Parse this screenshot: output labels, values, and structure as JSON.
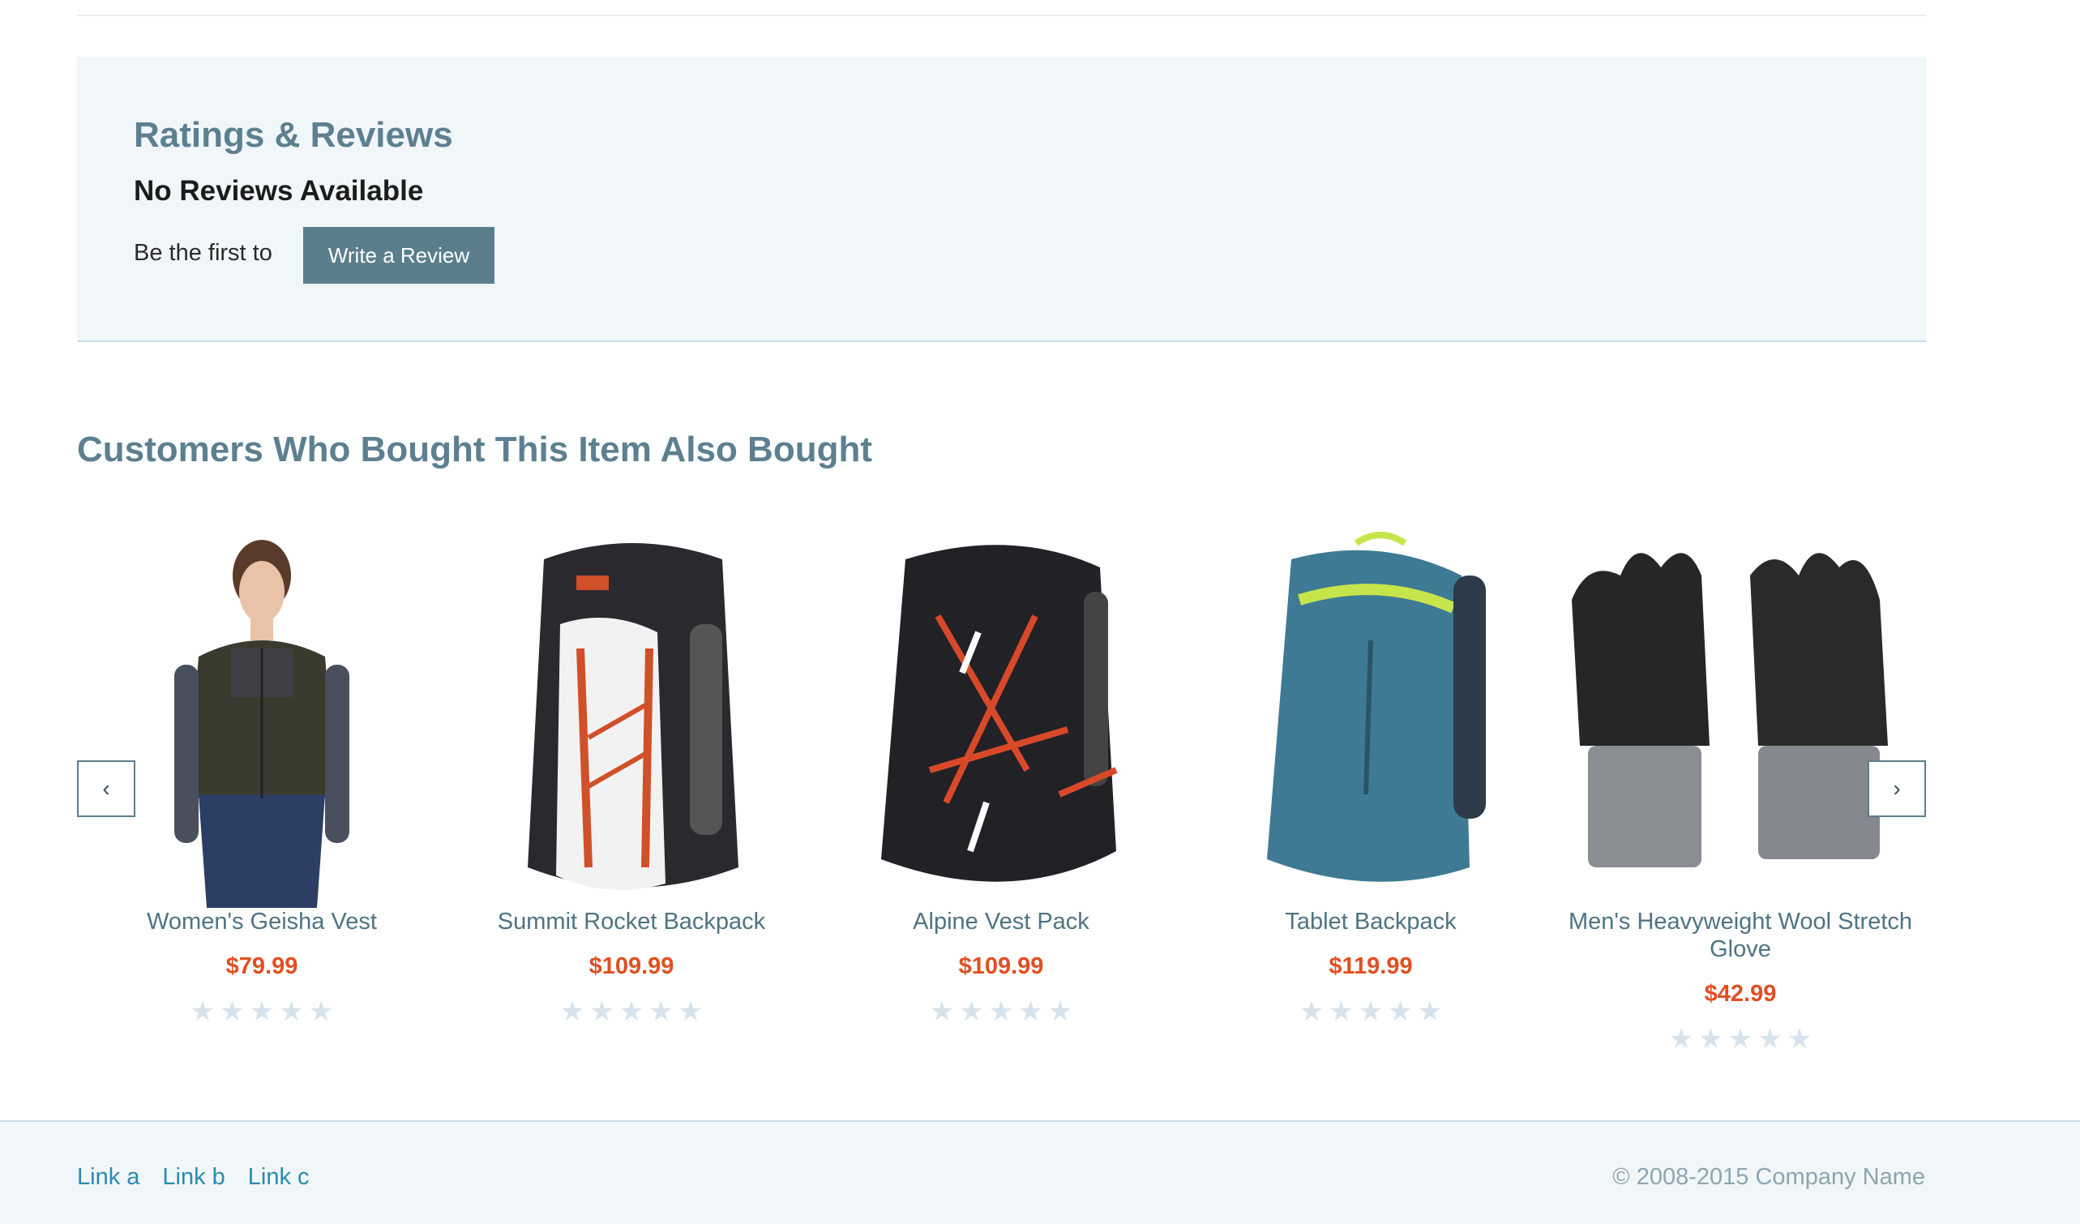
{
  "reviews": {
    "title": "Ratings & Reviews",
    "empty_text": "No Reviews Available",
    "prompt": "Be the first to",
    "write_button": "Write a Review"
  },
  "also_bought": {
    "title": "Customers Who Bought This Item Also Bought",
    "prev_icon": "chevron-left-icon",
    "next_icon": "chevron-right-icon",
    "items": [
      {
        "name": "Women's Geisha Vest",
        "price": "$79.99",
        "rating": 0,
        "max_rating": 5
      },
      {
        "name": "Summit Rocket Backpack",
        "price": "$109.99",
        "rating": 0,
        "max_rating": 5
      },
      {
        "name": "Alpine Vest Pack",
        "price": "$109.99",
        "rating": 0,
        "max_rating": 5
      },
      {
        "name": "Tablet Backpack",
        "price": "$119.99",
        "rating": 0,
        "max_rating": 5
      },
      {
        "name": "Men's Heavyweight Wool Stretch Glove",
        "price": "$42.99",
        "rating": 0,
        "max_rating": 5
      }
    ]
  },
  "footer": {
    "links": [
      "Link a",
      "Link b",
      "Link c"
    ],
    "copyright": "© 2008-2015 Company Name"
  },
  "colors": {
    "accent": "#5b7e8d",
    "price": "#e14f21",
    "link": "#2b8ab0",
    "panel_bg": "#f1f6f9",
    "star_empty": "#d7e3ec"
  }
}
